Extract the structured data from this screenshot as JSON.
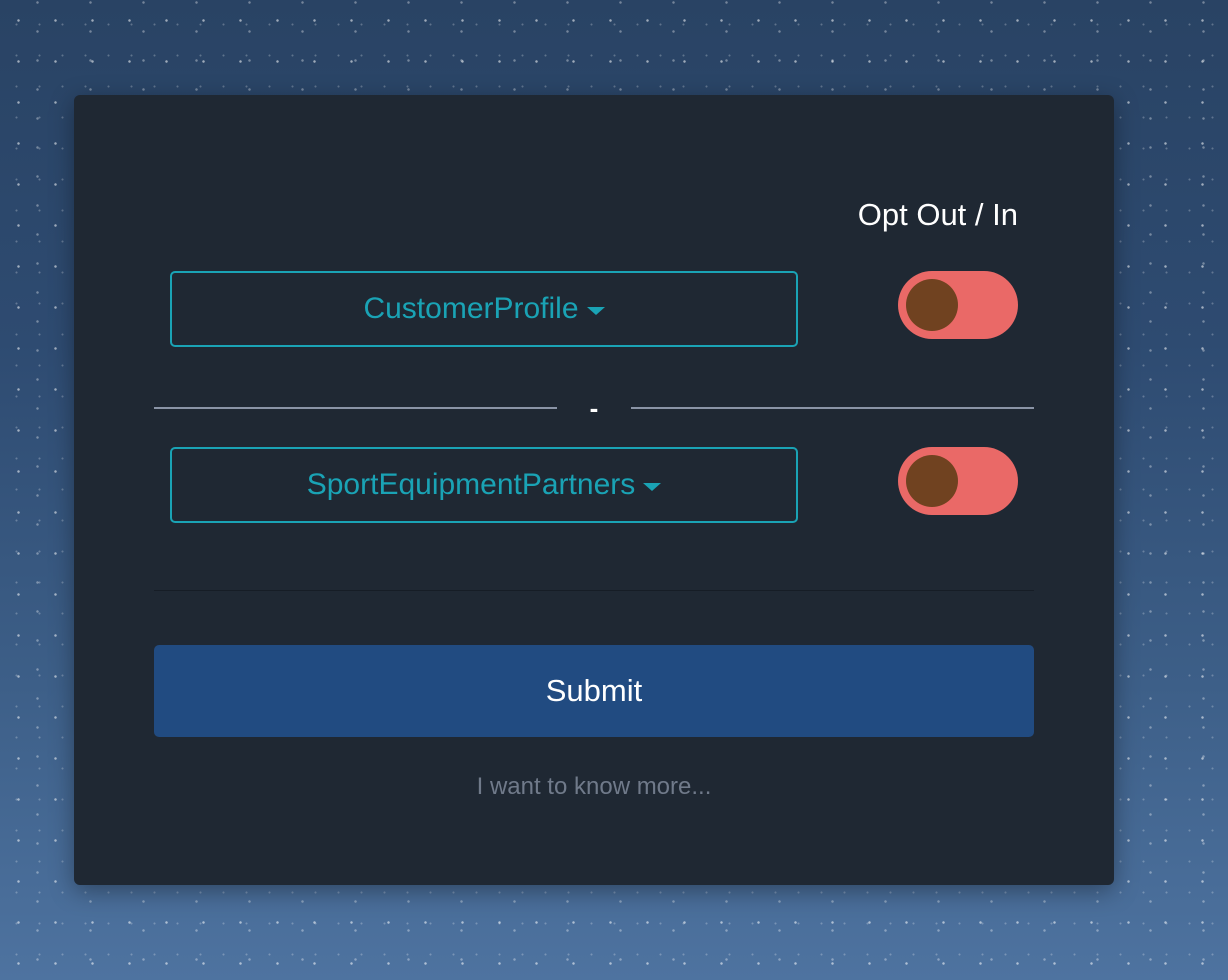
{
  "form": {
    "header": "Opt Out / In",
    "rows": [
      {
        "dropdown_label": "CustomerProfile",
        "toggle_state": "off"
      },
      {
        "dropdown_label": "SportEquipmentPartners",
        "toggle_state": "off"
      }
    ],
    "divider_text": "-",
    "submit_label": "Submit",
    "more_link": "I want to know more..."
  },
  "colors": {
    "card_background": "#1f2833",
    "accent": "#1aa3b5",
    "toggle_track_off": "#ea6967",
    "toggle_knob": "#704220",
    "submit_button": "#214b81",
    "muted_link": "#707a8a"
  },
  "icons": [
    "caret-down-icon"
  ]
}
